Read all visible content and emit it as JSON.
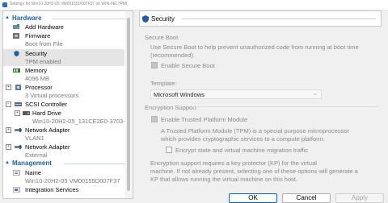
{
  "window": {
    "title": "Settings for Win10-20H2-05 VM00155D007F37 on WIN-0EL7PMI"
  },
  "sidebar": {
    "hardware_header": "Hardware",
    "management_header": "Management",
    "items": [
      {
        "label": "Add Hardware"
      },
      {
        "label": "Firmware",
        "sub": "Boot from File"
      },
      {
        "label": "Security",
        "sub": "TPM enabled"
      },
      {
        "label": "Memory",
        "sub": "4096 MB"
      },
      {
        "label": "Processor",
        "sub": "3 Virtual processors"
      },
      {
        "label": "SCSI Controller"
      },
      {
        "label": "Hard Drive",
        "sub": "Win10-20H2-05_131CE2E0-3703-4..."
      },
      {
        "label": "Network Adapter",
        "sub": "VLAN1"
      },
      {
        "label": "Network Adapter",
        "sub": "External"
      },
      {
        "label": "Name",
        "sub": "Win10-20H2-05 VM00155D007F37"
      },
      {
        "label": "Integration Services"
      }
    ]
  },
  "panel": {
    "title": "Security",
    "secure_boot": {
      "header": "Secure Boot",
      "desc": [
        "Use Secure Boot to help prevent unauthorized code from running at boot time",
        "(recommended)."
      ],
      "enable_label": "Enable Secure Boot",
      "template_label": "Template:",
      "template_value": "Microsoft Windows"
    },
    "encryption": {
      "header": "Encryption Support",
      "tpm_label": "Enable Trusted Platform Module",
      "tpm_desc": [
        "A Trusted Platform Module (TPM) is a special purpose microprocessor",
        "which provides cryptographic services to a compute platform."
      ],
      "encrypt_label": "Encrypt state and virtual machine migration traffic",
      "note": [
        "Encryption support requires a key protector (KP) for the virtual",
        "machine. If not already present, selecting one of these options will generate a",
        "KP that allows running the virtual machine on this host."
      ]
    }
  },
  "buttons": {
    "ok": "OK",
    "cancel": "Cancel",
    "apply": "Apply"
  }
}
